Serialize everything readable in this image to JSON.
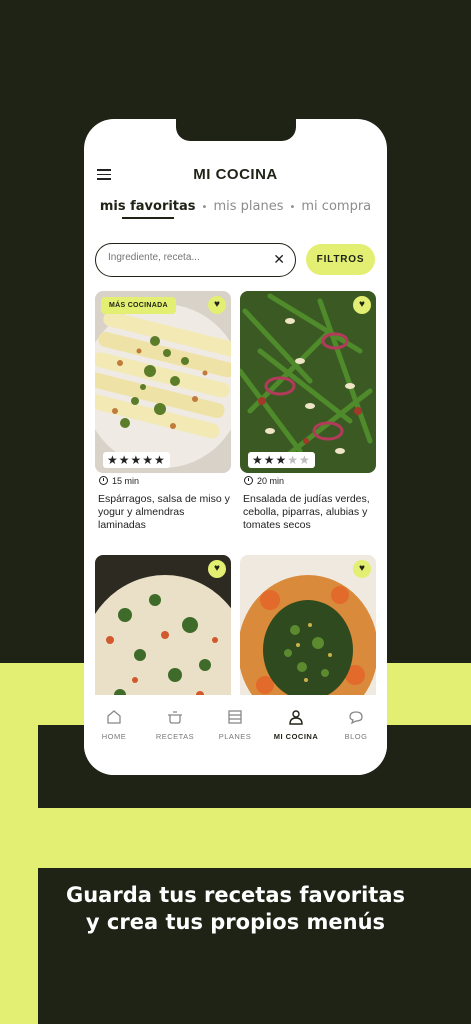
{
  "colors": {
    "accent": "#e2ef72",
    "dark": "#1f2316"
  },
  "tagline": {
    "line1": "Guarda tus recetas favoritas",
    "line2": "y crea tus propios menús"
  },
  "app": {
    "title": "MI COCINA"
  },
  "tabs": [
    {
      "label": "mis favoritas",
      "active": true
    },
    {
      "label": "mis planes",
      "active": false
    },
    {
      "label": "mi compra",
      "active": false
    }
  ],
  "tab_separator": "•",
  "search": {
    "placeholder": "Ingrediente, receta...",
    "clear_icon": "close-icon"
  },
  "filters_label": "FILTROS",
  "recipes": [
    {
      "badge": "MÁS COCINADA",
      "time": "15 min",
      "title": "Espárragos, salsa de miso y yogur y almendras laminadas",
      "rating": 5,
      "favorite": true
    },
    {
      "badge": "",
      "time": "20 min",
      "title": "Ensalada de judías verdes, cebolla, piparras, alubias y tomates secos",
      "rating": 3,
      "favorite": true
    },
    {
      "badge": "",
      "time": "",
      "title": "",
      "rating": null,
      "favorite": true
    },
    {
      "badge": "",
      "time": "",
      "title": "",
      "rating": null,
      "favorite": true
    }
  ],
  "nav": [
    {
      "label": "HOME",
      "icon": "home-icon"
    },
    {
      "label": "RECETAS",
      "icon": "pot-icon"
    },
    {
      "label": "PLANES",
      "icon": "calendar-icon"
    },
    {
      "label": "MI COCINA",
      "icon": "user-icon",
      "active": true
    },
    {
      "label": "BLOG",
      "icon": "chat-icon"
    }
  ]
}
